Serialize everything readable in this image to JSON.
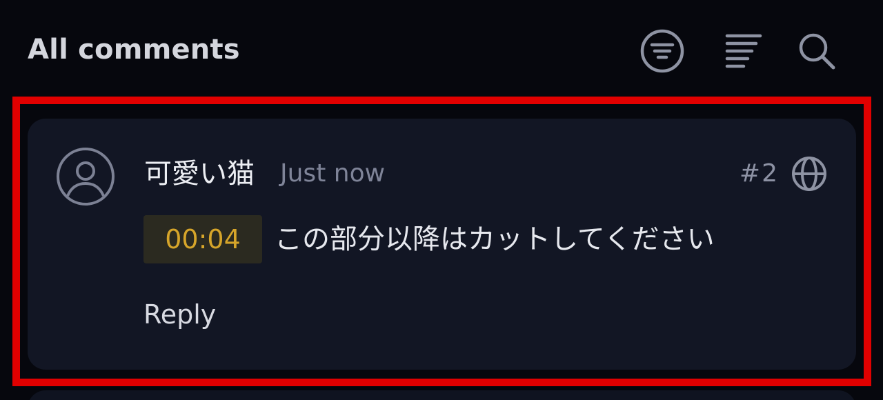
{
  "header": {
    "title": "All comments",
    "icons": [
      "filter-circle-icon",
      "sort-lines-icon",
      "search-icon"
    ]
  },
  "comment": {
    "username": "可愛い猫",
    "timestamp": "Just now",
    "number": "#2",
    "timecode": "00:04",
    "text": "この部分以降はカットしてください",
    "reply_label": "Reply",
    "avatar_icon": "user-avatar-icon",
    "visibility_icon": "globe-icon"
  },
  "colors": {
    "background": "#06070d",
    "card": "#121624",
    "highlight_border": "#e10000",
    "timecode_text": "#d6a52a",
    "timecode_bg": "#2b2a20",
    "muted_text": "#7f8498"
  }
}
